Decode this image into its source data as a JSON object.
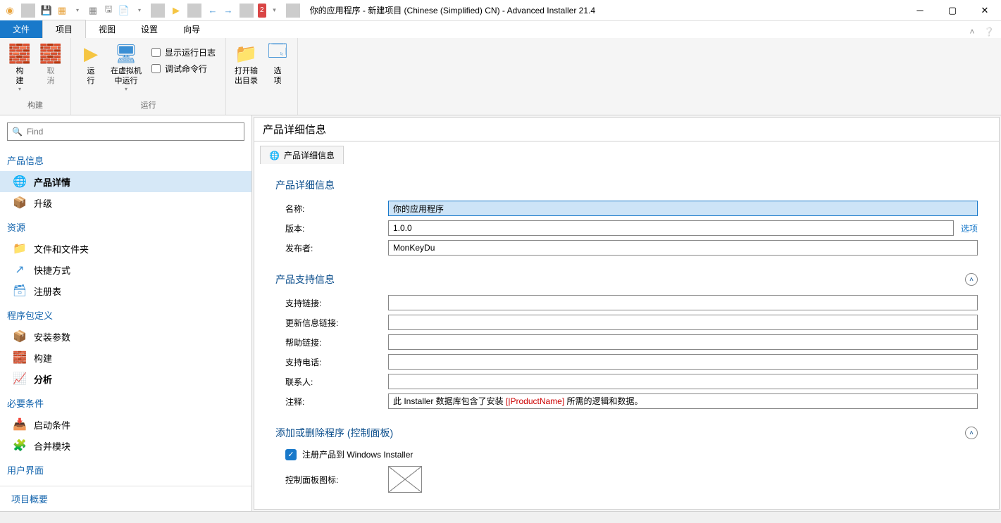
{
  "titlebar": {
    "title": "你的应用程序 - 新建项目 (Chinese (Simplified) CN) - Advanced Installer 21.4",
    "badge": "2"
  },
  "menu": {
    "file": "文件",
    "project": "项目",
    "view": "视图",
    "settings": "设置",
    "wizard": "向导"
  },
  "ribbon": {
    "group_build": "构建",
    "group_run": "运行",
    "btn_build": "构\n建",
    "btn_cancel": "取\n消",
    "btn_run": "运\n行",
    "btn_runvm": "在虚拟机\n中运行",
    "chk_log": "显示运行日志",
    "chk_debug": "调试命令行",
    "btn_opendir": "打开输\n出目录",
    "btn_options": "选\n项"
  },
  "search": {
    "placeholder": "Find"
  },
  "nav": {
    "s_product": "产品信息",
    "i_details": "产品详情",
    "i_upgrade": "升级",
    "s_resources": "资源",
    "i_files": "文件和文件夹",
    "i_shortcuts": "快捷方式",
    "i_registry": "注册表",
    "s_pkgdef": "程序包定义",
    "i_install": "安装参数",
    "i_build": "构建",
    "i_analyze": "分析",
    "s_prereq": "必要条件",
    "i_launch": "启动条件",
    "i_merge": "合并模块",
    "s_ui": "用户界面",
    "summary": "项目概要"
  },
  "content": {
    "title": "产品详细信息",
    "tab": "产品详细信息",
    "sec_product": "产品详细信息",
    "f_name": "名称:",
    "v_name": "你的应用程序",
    "f_version": "版本:",
    "v_version": "1.0.0",
    "l_options": "选项",
    "f_publisher": "发布者:",
    "v_publisher": "MonKeyDu",
    "sec_support": "产品支持信息",
    "f_supportlink": "支持链接:",
    "f_updatelink": "更新信息链接:",
    "f_helplink": "帮助链接:",
    "f_phone": "支持电话:",
    "f_contact": "联系人:",
    "f_comment": "注释:",
    "v_comment_pre": "此 Installer 数据库包含了安装 ",
    "v_comment_pn": "[|ProductName]",
    "v_comment_post": " 所需的逻辑和数据。",
    "sec_arp": "添加或删除程序 (控制面板)",
    "chk_register": "注册产品到 Windows Installer",
    "f_cpicon": "控制面板图标:"
  }
}
